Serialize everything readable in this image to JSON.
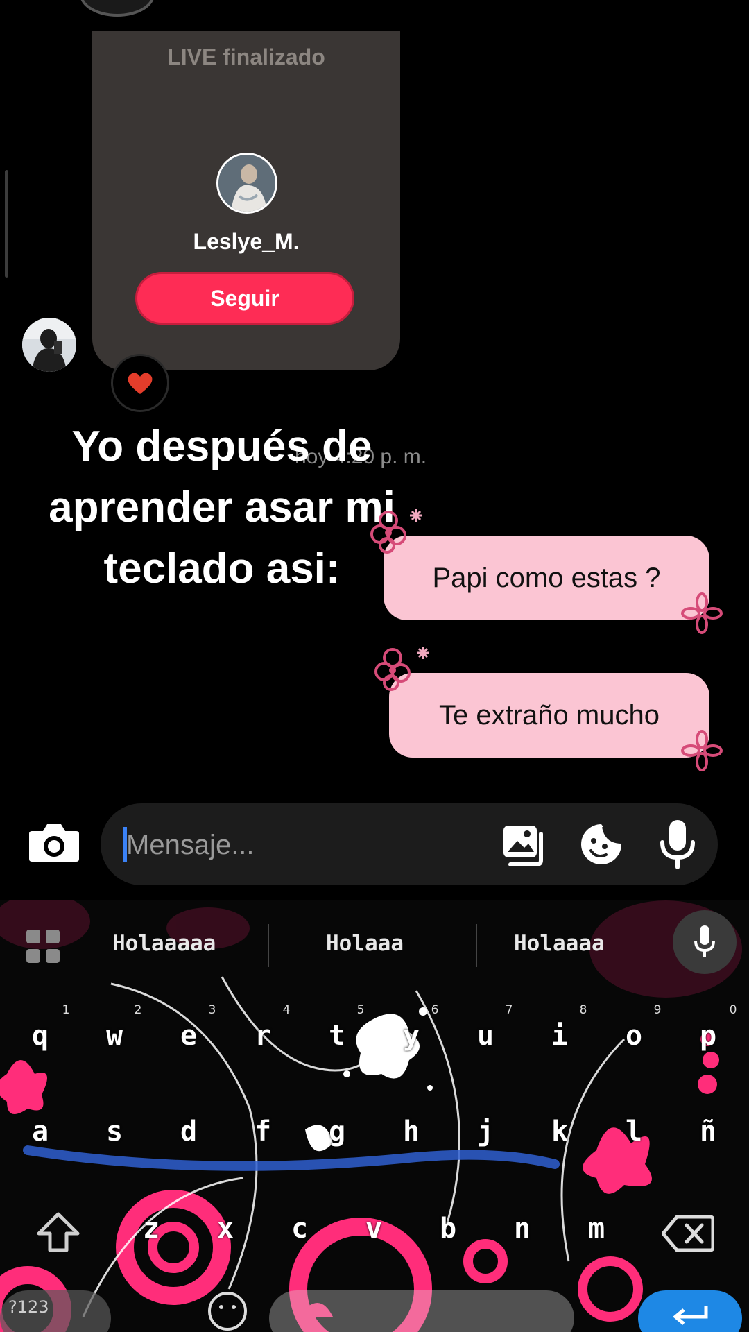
{
  "live_card": {
    "title": "LIVE finalizado",
    "username": "Leslye_M.",
    "follow_label": "Seguir"
  },
  "reaction": {
    "icon": "heart-icon",
    "color": "#e43d2b"
  },
  "timestamp": "hoy 4:20 p. m.",
  "overlay_caption": "Yo después de aprender asar mi teclado asi:",
  "messages": [
    {
      "text": "Papi como estas ?"
    },
    {
      "text": "Te extraño mucho"
    }
  ],
  "composer": {
    "placeholder": "Mensaje...",
    "camera_icon": "camera-icon",
    "gallery_icon": "gallery-icon",
    "sticker_icon": "sticker-icon",
    "mic_icon": "microphone-icon"
  },
  "keyboard": {
    "suggestions": [
      "Holaaaaa",
      "Holaaa",
      "Holaaaa"
    ],
    "row1": [
      "q",
      "w",
      "e",
      "r",
      "t",
      "y",
      "u",
      "i",
      "o",
      "p"
    ],
    "row1_hints": [
      "1",
      "2",
      "3",
      "4",
      "5",
      "6",
      "7",
      "8",
      "9",
      "0"
    ],
    "row2": [
      "a",
      "s",
      "d",
      "f",
      "g",
      "h",
      "j",
      "k",
      "l",
      "ñ"
    ],
    "row3": [
      "z",
      "x",
      "c",
      "v",
      "b",
      "n",
      "m"
    ],
    "symbols_label": "?123",
    "accent_color": "#ff2d7a",
    "enter_color": "#1e88e5"
  }
}
